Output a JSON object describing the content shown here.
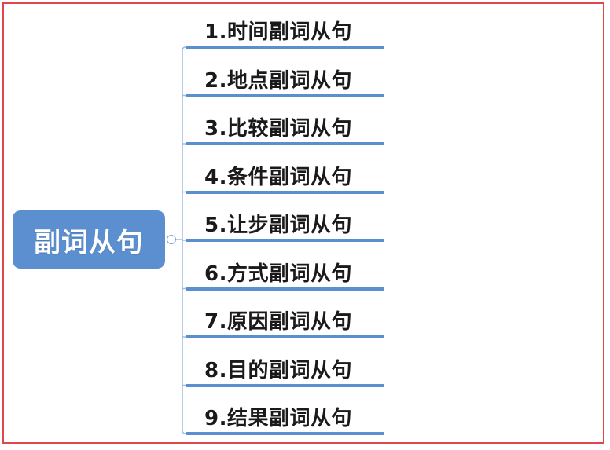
{
  "root": {
    "label": "副词从句",
    "color": "#5b8fcf"
  },
  "branches": [
    {
      "label": "1.时间副词从句"
    },
    {
      "label": "2.地点副词从句"
    },
    {
      "label": "3.比较副词从句"
    },
    {
      "label": "4.条件副词从句"
    },
    {
      "label": "5.让步副词从句"
    },
    {
      "label": "6.方式副词从句"
    },
    {
      "label": "7.原因副词从句"
    },
    {
      "label": "8.目的副词从句"
    },
    {
      "label": "9.结果副词从句"
    }
  ],
  "colors": {
    "frame_border": "#e0474c",
    "connector": "#9fbbe0",
    "underline": "#5b8fcf"
  }
}
